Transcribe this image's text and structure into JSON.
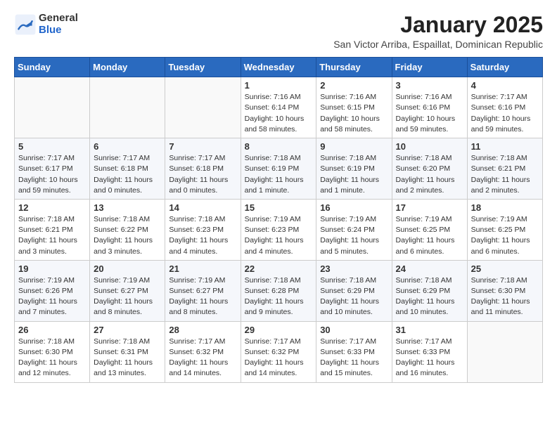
{
  "logo": {
    "general": "General",
    "blue": "Blue"
  },
  "title": "January 2025",
  "subtitle": "San Victor Arriba, Espaillat, Dominican Republic",
  "days_of_week": [
    "Sunday",
    "Monday",
    "Tuesday",
    "Wednesday",
    "Thursday",
    "Friday",
    "Saturday"
  ],
  "weeks": [
    [
      {
        "day": "",
        "info": ""
      },
      {
        "day": "",
        "info": ""
      },
      {
        "day": "",
        "info": ""
      },
      {
        "day": "1",
        "info": "Sunrise: 7:16 AM\nSunset: 6:14 PM\nDaylight: 10 hours and 58 minutes."
      },
      {
        "day": "2",
        "info": "Sunrise: 7:16 AM\nSunset: 6:15 PM\nDaylight: 10 hours and 58 minutes."
      },
      {
        "day": "3",
        "info": "Sunrise: 7:16 AM\nSunset: 6:16 PM\nDaylight: 10 hours and 59 minutes."
      },
      {
        "day": "4",
        "info": "Sunrise: 7:17 AM\nSunset: 6:16 PM\nDaylight: 10 hours and 59 minutes."
      }
    ],
    [
      {
        "day": "5",
        "info": "Sunrise: 7:17 AM\nSunset: 6:17 PM\nDaylight: 10 hours and 59 minutes."
      },
      {
        "day": "6",
        "info": "Sunrise: 7:17 AM\nSunset: 6:18 PM\nDaylight: 11 hours and 0 minutes."
      },
      {
        "day": "7",
        "info": "Sunrise: 7:17 AM\nSunset: 6:18 PM\nDaylight: 11 hours and 0 minutes."
      },
      {
        "day": "8",
        "info": "Sunrise: 7:18 AM\nSunset: 6:19 PM\nDaylight: 11 hours and 1 minute."
      },
      {
        "day": "9",
        "info": "Sunrise: 7:18 AM\nSunset: 6:19 PM\nDaylight: 11 hours and 1 minute."
      },
      {
        "day": "10",
        "info": "Sunrise: 7:18 AM\nSunset: 6:20 PM\nDaylight: 11 hours and 2 minutes."
      },
      {
        "day": "11",
        "info": "Sunrise: 7:18 AM\nSunset: 6:21 PM\nDaylight: 11 hours and 2 minutes."
      }
    ],
    [
      {
        "day": "12",
        "info": "Sunrise: 7:18 AM\nSunset: 6:21 PM\nDaylight: 11 hours and 3 minutes."
      },
      {
        "day": "13",
        "info": "Sunrise: 7:18 AM\nSunset: 6:22 PM\nDaylight: 11 hours and 3 minutes."
      },
      {
        "day": "14",
        "info": "Sunrise: 7:18 AM\nSunset: 6:23 PM\nDaylight: 11 hours and 4 minutes."
      },
      {
        "day": "15",
        "info": "Sunrise: 7:19 AM\nSunset: 6:23 PM\nDaylight: 11 hours and 4 minutes."
      },
      {
        "day": "16",
        "info": "Sunrise: 7:19 AM\nSunset: 6:24 PM\nDaylight: 11 hours and 5 minutes."
      },
      {
        "day": "17",
        "info": "Sunrise: 7:19 AM\nSunset: 6:25 PM\nDaylight: 11 hours and 6 minutes."
      },
      {
        "day": "18",
        "info": "Sunrise: 7:19 AM\nSunset: 6:25 PM\nDaylight: 11 hours and 6 minutes."
      }
    ],
    [
      {
        "day": "19",
        "info": "Sunrise: 7:19 AM\nSunset: 6:26 PM\nDaylight: 11 hours and 7 minutes."
      },
      {
        "day": "20",
        "info": "Sunrise: 7:19 AM\nSunset: 6:27 PM\nDaylight: 11 hours and 8 minutes."
      },
      {
        "day": "21",
        "info": "Sunrise: 7:19 AM\nSunset: 6:27 PM\nDaylight: 11 hours and 8 minutes."
      },
      {
        "day": "22",
        "info": "Sunrise: 7:18 AM\nSunset: 6:28 PM\nDaylight: 11 hours and 9 minutes."
      },
      {
        "day": "23",
        "info": "Sunrise: 7:18 AM\nSunset: 6:29 PM\nDaylight: 11 hours and 10 minutes."
      },
      {
        "day": "24",
        "info": "Sunrise: 7:18 AM\nSunset: 6:29 PM\nDaylight: 11 hours and 10 minutes."
      },
      {
        "day": "25",
        "info": "Sunrise: 7:18 AM\nSunset: 6:30 PM\nDaylight: 11 hours and 11 minutes."
      }
    ],
    [
      {
        "day": "26",
        "info": "Sunrise: 7:18 AM\nSunset: 6:30 PM\nDaylight: 11 hours and 12 minutes."
      },
      {
        "day": "27",
        "info": "Sunrise: 7:18 AM\nSunset: 6:31 PM\nDaylight: 11 hours and 13 minutes."
      },
      {
        "day": "28",
        "info": "Sunrise: 7:17 AM\nSunset: 6:32 PM\nDaylight: 11 hours and 14 minutes."
      },
      {
        "day": "29",
        "info": "Sunrise: 7:17 AM\nSunset: 6:32 PM\nDaylight: 11 hours and 14 minutes."
      },
      {
        "day": "30",
        "info": "Sunrise: 7:17 AM\nSunset: 6:33 PM\nDaylight: 11 hours and 15 minutes."
      },
      {
        "day": "31",
        "info": "Sunrise: 7:17 AM\nSunset: 6:33 PM\nDaylight: 11 hours and 16 minutes."
      },
      {
        "day": "",
        "info": ""
      }
    ]
  ]
}
